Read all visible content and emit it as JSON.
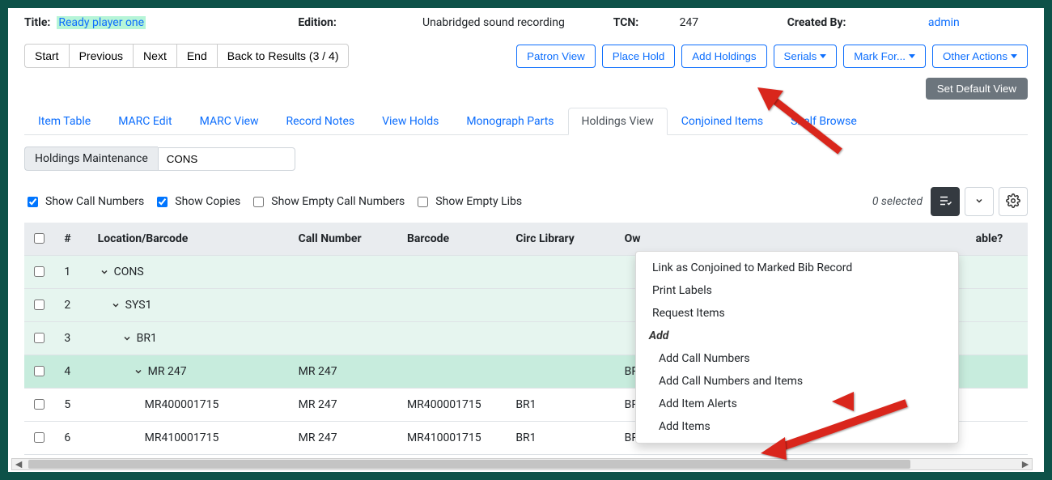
{
  "summary": {
    "title_label": "Title:",
    "title_value": "Ready player one",
    "edition_label": "Edition:",
    "edition_value": "Unabridged sound recording",
    "tcn_label": "TCN:",
    "tcn_value": "247",
    "created_by_label": "Created By:",
    "created_by_value": "admin"
  },
  "nav": {
    "start": "Start",
    "previous": "Previous",
    "next": "Next",
    "end": "End",
    "back": "Back to Results (3 / 4)"
  },
  "actions": {
    "patron_view": "Patron View",
    "place_hold": "Place Hold",
    "add_holdings": "Add Holdings",
    "serials": "Serials",
    "mark_for": "Mark For...",
    "other_actions": "Other Actions",
    "set_default_view": "Set Default View"
  },
  "tabs": {
    "item_table": "Item Table",
    "marc_edit": "MARC Edit",
    "marc_view": "MARC View",
    "record_notes": "Record Notes",
    "view_holds": "View Holds",
    "monograph_parts": "Monograph Parts",
    "holdings_view": "Holdings View",
    "conjoined_items": "Conjoined Items",
    "shelf_browse": "Shelf Browse"
  },
  "hm": {
    "label": "Holdings Maintenance",
    "value": "CONS"
  },
  "checks": {
    "show_call_numbers": "Show Call Numbers",
    "show_copies": "Show Copies",
    "show_empty_call_numbers": "Show Empty Call Numbers",
    "show_empty_libs": "Show Empty Libs"
  },
  "selected_text": "0 selected",
  "columns": {
    "num": "#",
    "location": "Location/Barcode",
    "call_number": "Call Number",
    "barcode": "Barcode",
    "circ_library": "Circ Library",
    "owning": "Ow",
    "able": "able?"
  },
  "rows": [
    {
      "n": "1",
      "loc": "CONS",
      "call": "",
      "barcode": "",
      "circ": "",
      "own": "",
      "indent": 0
    },
    {
      "n": "2",
      "loc": "SYS1",
      "call": "",
      "barcode": "",
      "circ": "",
      "own": "",
      "indent": 1
    },
    {
      "n": "3",
      "loc": "BR1",
      "call": "",
      "barcode": "",
      "circ": "",
      "own": "",
      "indent": 2
    },
    {
      "n": "4",
      "loc": "MR 247",
      "call": "MR 247",
      "barcode": "",
      "circ": "",
      "own": "BR",
      "indent": 3
    },
    {
      "n": "5",
      "loc": "MR400001715",
      "call": "MR 247",
      "barcode": "MR400001715",
      "circ": "BR1",
      "own": "BR",
      "indent": 4
    },
    {
      "n": "6",
      "loc": "MR410001715",
      "call": "MR 247",
      "barcode": "MR410001715",
      "circ": "BR1",
      "own": "BR",
      "indent": 4
    }
  ],
  "menu": {
    "link_conjoined": "Link as Conjoined to Marked Bib Record",
    "print_labels": "Print Labels",
    "request_items": "Request Items",
    "add_head": "Add",
    "add_call_numbers": "Add Call Numbers",
    "add_call_numbers_items": "Add Call Numbers and Items",
    "add_item_alerts": "Add Item Alerts",
    "add_items": "Add Items"
  }
}
